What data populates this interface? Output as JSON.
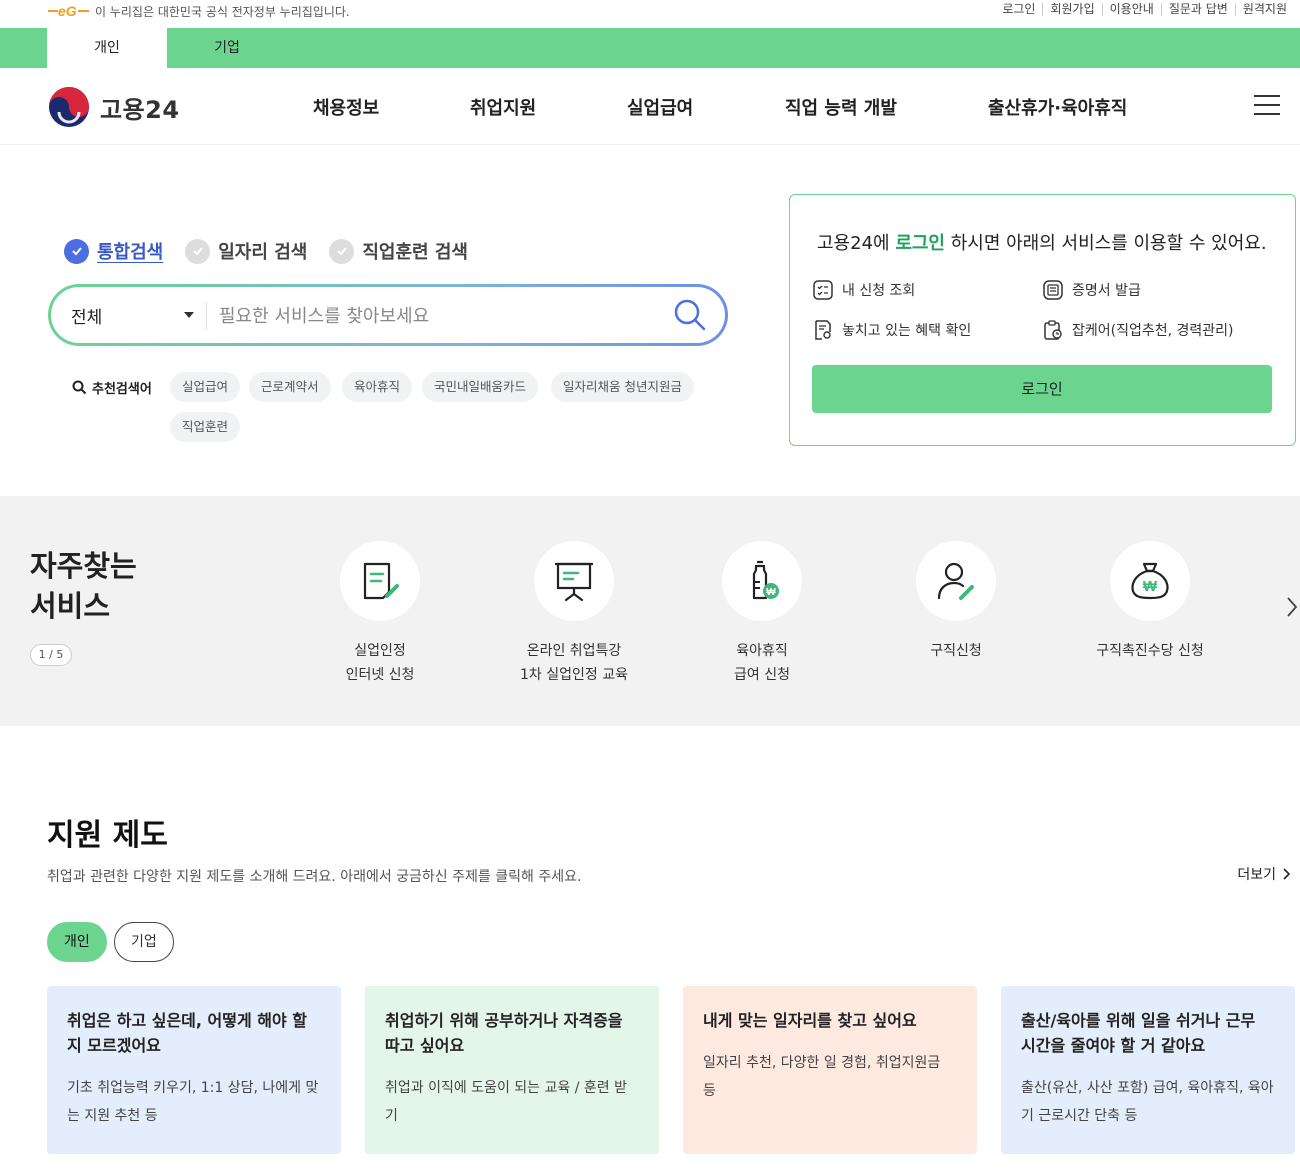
{
  "gov_strip": {
    "text": "이 누리집은 대한민국 공식 전자정부 누리집입니다.",
    "links": [
      "로그인",
      "회원가입",
      "이용안내",
      "질문과 답변",
      "원격지원"
    ]
  },
  "user_tabs": [
    "개인",
    "기업"
  ],
  "header": {
    "logo_text": "고용24",
    "nav": [
      "채용정보",
      "취업지원",
      "실업급여",
      "직업 능력 개발",
      "출산휴가·육아휴직"
    ]
  },
  "search": {
    "tabs": [
      "통합검색",
      "일자리 검색",
      "직업훈련 검색"
    ],
    "select_value": "전체",
    "placeholder": "필요한 서비스를 찾아보세요",
    "recommend_label": "추천검색어",
    "keywords": [
      "실업급여",
      "근로계약서",
      "육아휴직",
      "국민내일배움카드",
      "일자리채움 청년지원금",
      "직업훈련"
    ]
  },
  "login_box": {
    "title_prefix": "고용24에 ",
    "title_highlight": "로그인",
    "title_suffix": " 하시면 아래의 서비스를 이용할 수 있어요.",
    "services": [
      "내 신청 조회",
      "증명서 발급",
      "놓치고 있는 혜택 확인",
      "잡케어(직업추천, 경력관리)"
    ],
    "button": "로그인"
  },
  "frequent": {
    "title_line1": "자주찾는",
    "title_line2": "서비스",
    "pager": "1 / 5",
    "items": [
      {
        "label": "실업인정\n인터넷 신청",
        "icon": "document-pen-icon"
      },
      {
        "label": "온라인 취업특강\n1차 실업인정 교육",
        "icon": "presentation-board-icon"
      },
      {
        "label": "육아휴직\n급여 신청",
        "icon": "baby-bottle-won-icon"
      },
      {
        "label": "구직신청",
        "icon": "person-pen-icon"
      },
      {
        "label": "구직촉진수당 신청",
        "icon": "money-bag-won-icon"
      }
    ]
  },
  "support": {
    "title": "지원 제도",
    "description": "취업과 관련한 다양한 지원 제도를 소개해 드려요. 아래에서 궁금하신 주제를 클릭해 주세요.",
    "more": "더보기",
    "filters": [
      "개인",
      "기업"
    ],
    "cards": [
      {
        "title": "취업은 하고 싶은데, 어떻게 해야 할 지 모르겠어요",
        "desc": "기초 취업능력 키우기, 1:1 상담, 나에게 맞는 지원 추천 등",
        "color": "#e3edfb"
      },
      {
        "title": "취업하기 위해 공부하거나 자격증을 따고 싶어요",
        "desc": "취업과 이직에 도움이 되는 교육 / 훈련 받기",
        "color": "#e4f6ea"
      },
      {
        "title": "내게 맞는 일자리를 찾고 싶어요",
        "desc": "일자리 추천, 다양한 일 경험, 취업지원금 등",
        "color": "#fde9e0"
      },
      {
        "title": "출산/육아를 위해 일을 쉬거나 근무 시간을 줄여야 할 거 같아요",
        "desc": "출산(유산, 사산 포함) 급여, 육아휴직, 육아기 근로시간 단축 등",
        "color": "#e3edfb"
      }
    ]
  },
  "colors": {
    "brand_green": "#6bd58f",
    "accent_blue": "#4b6ee2",
    "highlight_green": "#1fa25a"
  }
}
